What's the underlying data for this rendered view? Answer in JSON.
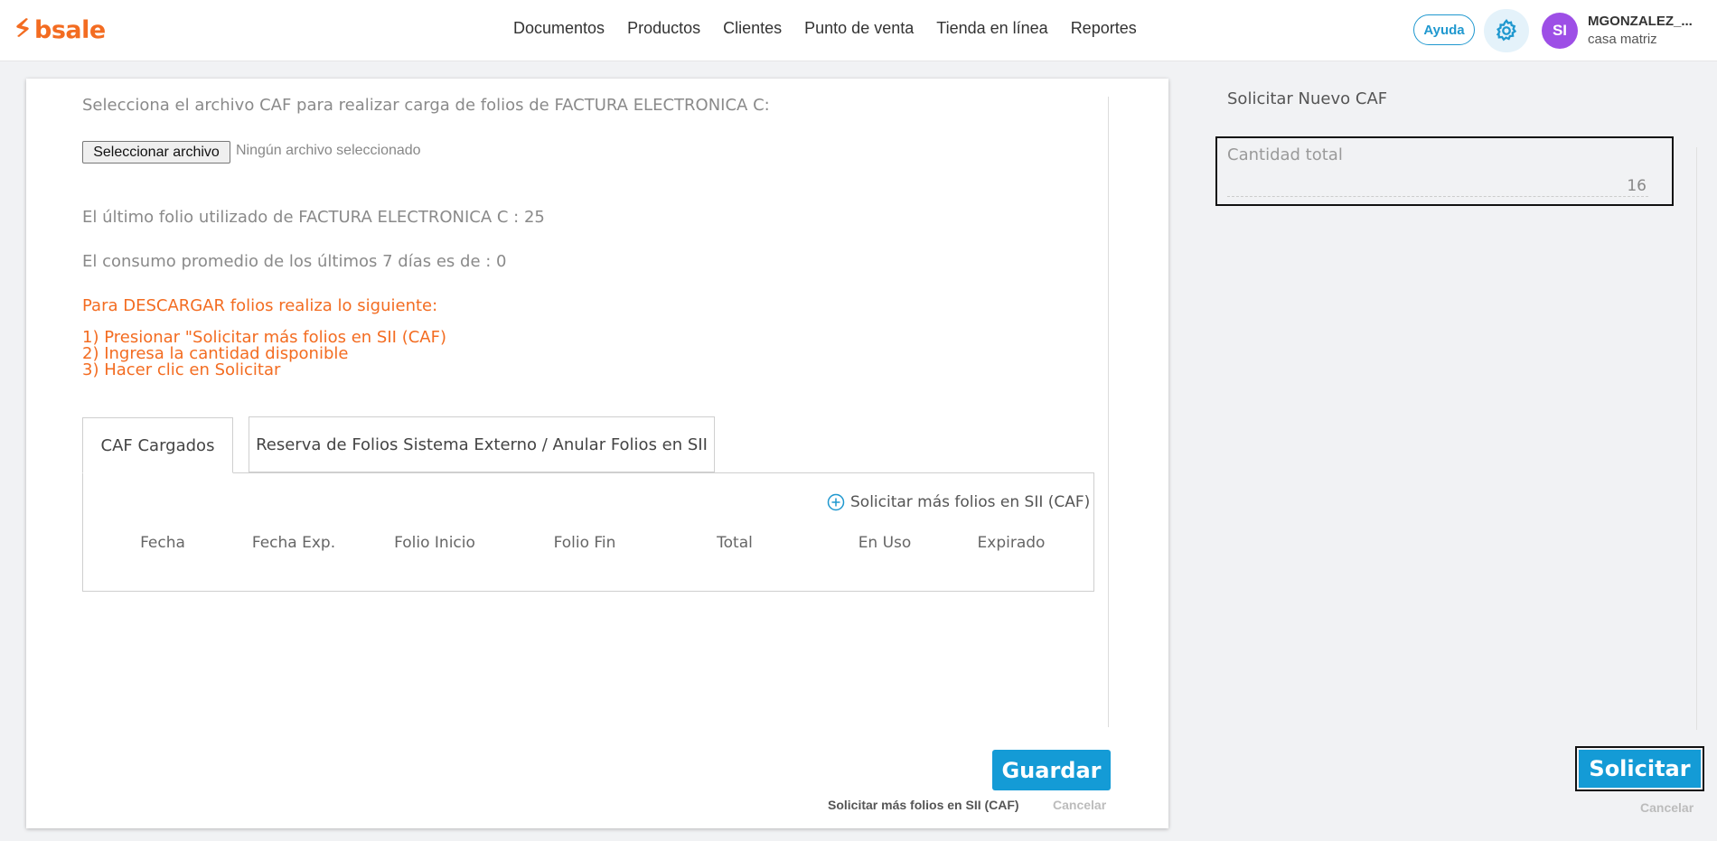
{
  "header": {
    "logo_text": "bsale",
    "nav": [
      "Documentos",
      "Productos",
      "Clientes",
      "Punto de venta",
      "Tienda en línea",
      "Reportes"
    ],
    "help_label": "Ayuda",
    "avatar_initials": "SI",
    "user_name": "MGONZALEZ_...",
    "user_branch": "casa matriz"
  },
  "main": {
    "file_prompt": "Selecciona el archivo CAF para realizar carga de folios de FACTURA ELECTRONICA C:",
    "file_button": "Seleccionar archivo",
    "file_none": "Ningún archivo seleccionado",
    "last_folio": "El último folio utilizado de FACTURA ELECTRONICA C : 25",
    "avg_consumption": "El consumo promedio de los últimos 7 días es de : 0",
    "instructions_title": "Para DESCARGAR folios realiza lo siguiente:",
    "steps": [
      "1) Presionar \"Solicitar más folios en SII (CAF)",
      "2) Ingresa la cantidad disponible",
      "3) Hacer clic en Solicitar"
    ],
    "tabs": [
      {
        "label": "CAF Cargados"
      },
      {
        "label": "Reserva de Folios Sistema Externo / Anular Folios en SII"
      }
    ],
    "request_link": "Solicitar más folios en SII (CAF)",
    "columns": [
      "Fecha",
      "Fecha Exp.",
      "Folio Inicio",
      "Folio Fin",
      "Total",
      "En Uso",
      "Expirado"
    ],
    "save_button": "Guardar",
    "footer_request_link": "Solicitar más folios en SII (CAF)",
    "footer_cancel": "Cancelar"
  },
  "side_panel": {
    "title": "Solicitar Nuevo CAF",
    "quantity_label": "Cantidad total",
    "quantity_value": "16",
    "submit_button": "Solicitar",
    "cancel": "Cancelar"
  },
  "colors": {
    "brand_orange": "#f36c21",
    "primary_blue": "#149bd6",
    "avatar_purple": "#9d4fe6"
  }
}
